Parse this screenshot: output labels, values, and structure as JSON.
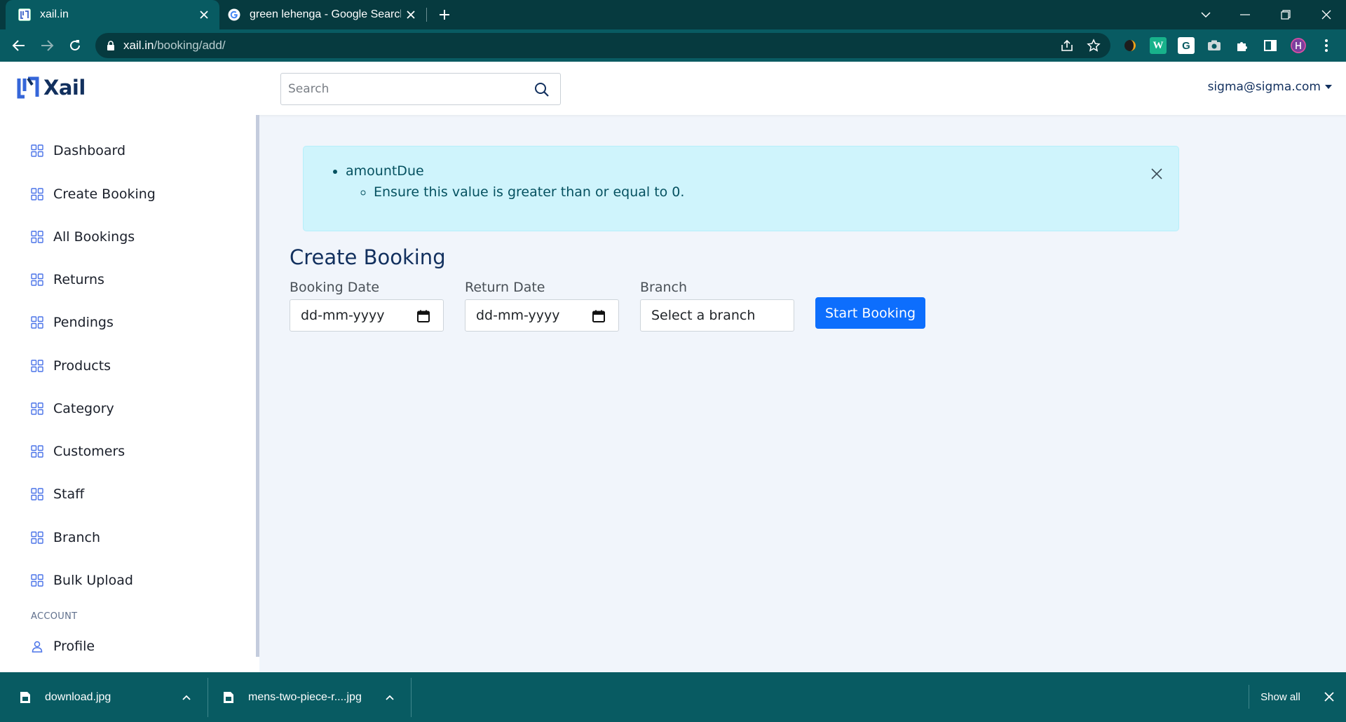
{
  "browser": {
    "tabs": [
      {
        "title": "xail.in",
        "icon": "xail-favicon"
      },
      {
        "title": "green lehenga - Google Search",
        "icon": "google-icon"
      }
    ],
    "url_host": "xail.in",
    "url_path": "/booking/add/",
    "extensions": [
      "brave-icon",
      "w-extension-icon",
      "grammarly-icon",
      "camera-icon",
      "puzzle-icon"
    ]
  },
  "header": {
    "brand": "Xail",
    "search_placeholder": "Search",
    "user_email": "sigma@sigma.com"
  },
  "sidebar": {
    "items": [
      {
        "label": "Dashboard"
      },
      {
        "label": "Create Booking"
      },
      {
        "label": "All Bookings"
      },
      {
        "label": "Returns"
      },
      {
        "label": "Pendings"
      },
      {
        "label": "Products"
      },
      {
        "label": "Category"
      },
      {
        "label": "Customers"
      },
      {
        "label": "Staff"
      },
      {
        "label": "Branch"
      },
      {
        "label": "Bulk Upload"
      }
    ],
    "account_section": "ACCOUNT",
    "account_items": [
      {
        "label": "Profile"
      }
    ]
  },
  "alert": {
    "field": "amountDue",
    "message": "Ensure this value is greater than or equal to 0."
  },
  "form": {
    "title": "Create Booking",
    "booking_date_label": "Booking Date",
    "booking_date_value": "dd-mm-yyyy",
    "return_date_label": "Return Date",
    "return_date_value": "dd-mm-yyyy",
    "branch_label": "Branch",
    "branch_value": "Select a branch",
    "submit_label": "Start Booking"
  },
  "downloads": {
    "items": [
      {
        "name": "download.jpg"
      },
      {
        "name": "mens-two-piece-r....jpg"
      }
    ],
    "show_all": "Show all"
  },
  "colors": {
    "chrome_dark": "#063a3f",
    "chrome": "#085b62",
    "brand": "#12305e",
    "accent": "#0d6efd",
    "alert_bg": "#cff4fc"
  }
}
